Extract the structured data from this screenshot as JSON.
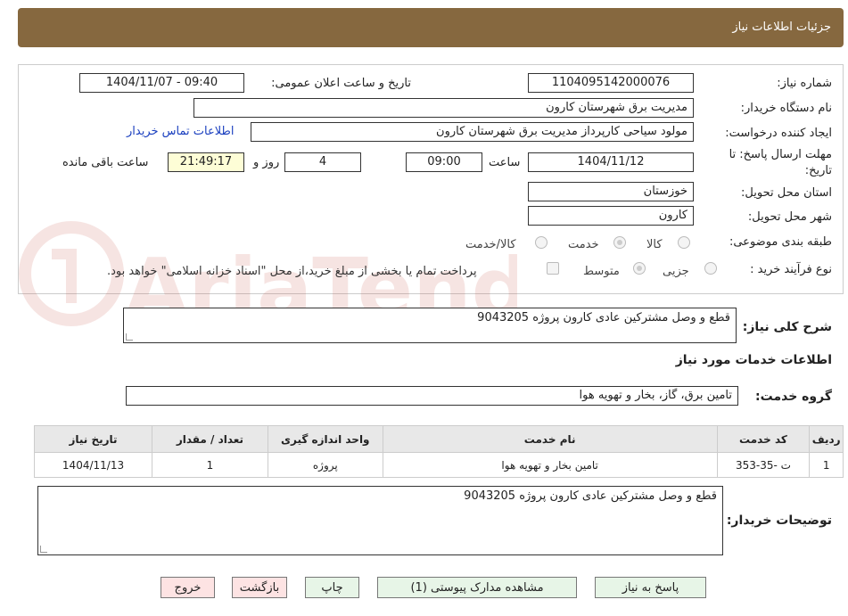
{
  "header": {
    "title": "جزئیات اطلاعات نیاز"
  },
  "fields": {
    "need_number_label": "شماره نیاز:",
    "need_number": "1104095142000076",
    "announce_label": "تاریخ و ساعت اعلان عمومی:",
    "announce_value": "1404/11/07 - 09:40",
    "buyer_org_label": "نام دستگاه خریدار:",
    "buyer_org": "مدیریت برق شهرستان کارون",
    "creator_label": "ایجاد کننده درخواست:",
    "creator": "مولود سیاحی کارپرداز مدیریت برق شهرستان کارون",
    "contact_link": "اطلاعات تماس خریدار",
    "deadline_label_1": "مهلت ارسال پاسخ: تا",
    "deadline_label_2": "تاریخ:",
    "deadline_date": "1404/11/12",
    "time_label": "ساعت",
    "deadline_time": "09:00",
    "days": "4",
    "days_label": "روز و",
    "remaining_time": "21:49:17",
    "remaining_label": "ساعت باقی مانده",
    "province_label": "استان محل تحویل:",
    "province": "خوزستان",
    "city_label": "شهر محل تحویل:",
    "city": "کارون",
    "category_label": "طبقه بندی موضوعی:",
    "category_options": [
      "کالا",
      "خدمت",
      "کالا/خدمت"
    ],
    "process_label": "نوع فرآیند خرید :",
    "process_options": [
      "جزیی",
      "متوسط"
    ],
    "payment_note": "پرداخت تمام یا بخشی از مبلغ خرید،از محل \"اسناد خزانه اسلامی\" خواهد بود."
  },
  "summary": {
    "label": "شرح کلی نیاز:",
    "value": "قطع و وصل مشترکین عادی کارون پروژه 9043205"
  },
  "services": {
    "section_title": "اطلاعات خدمات مورد نیاز",
    "group_label": "گروه خدمت:",
    "group_value": "تامین برق، گاز، بخار و تهویه هوا",
    "columns": [
      "ردیف",
      "کد خدمت",
      "نام خدمت",
      "واحد اندازه گیری",
      "تعداد / مقدار",
      "تاریخ نیاز"
    ],
    "rows": [
      [
        "1",
        "ت -35-353",
        "تامین بخار و تهویه هوا",
        "پروژه",
        "1",
        "1404/11/13"
      ]
    ]
  },
  "buyer_notes": {
    "label": "توضیحات خریدار:",
    "value": "قطع و وصل مشترکین عادی کارون پروژه 9043205"
  },
  "buttons": {
    "reply": "پاسخ به نیاز",
    "attachments": "مشاهده مدارک پیوستی (1)",
    "print": "چاپ",
    "back": "بازگشت",
    "exit": "خروج"
  },
  "watermark": {
    "text": "AriaTender.neT"
  },
  "colors": {
    "header_bg": "#86683f",
    "link": "#1a3fbf",
    "remaining_bg": "#fdfdd6",
    "button_green": "#e7f5e7",
    "button_red": "#fde3e3"
  }
}
